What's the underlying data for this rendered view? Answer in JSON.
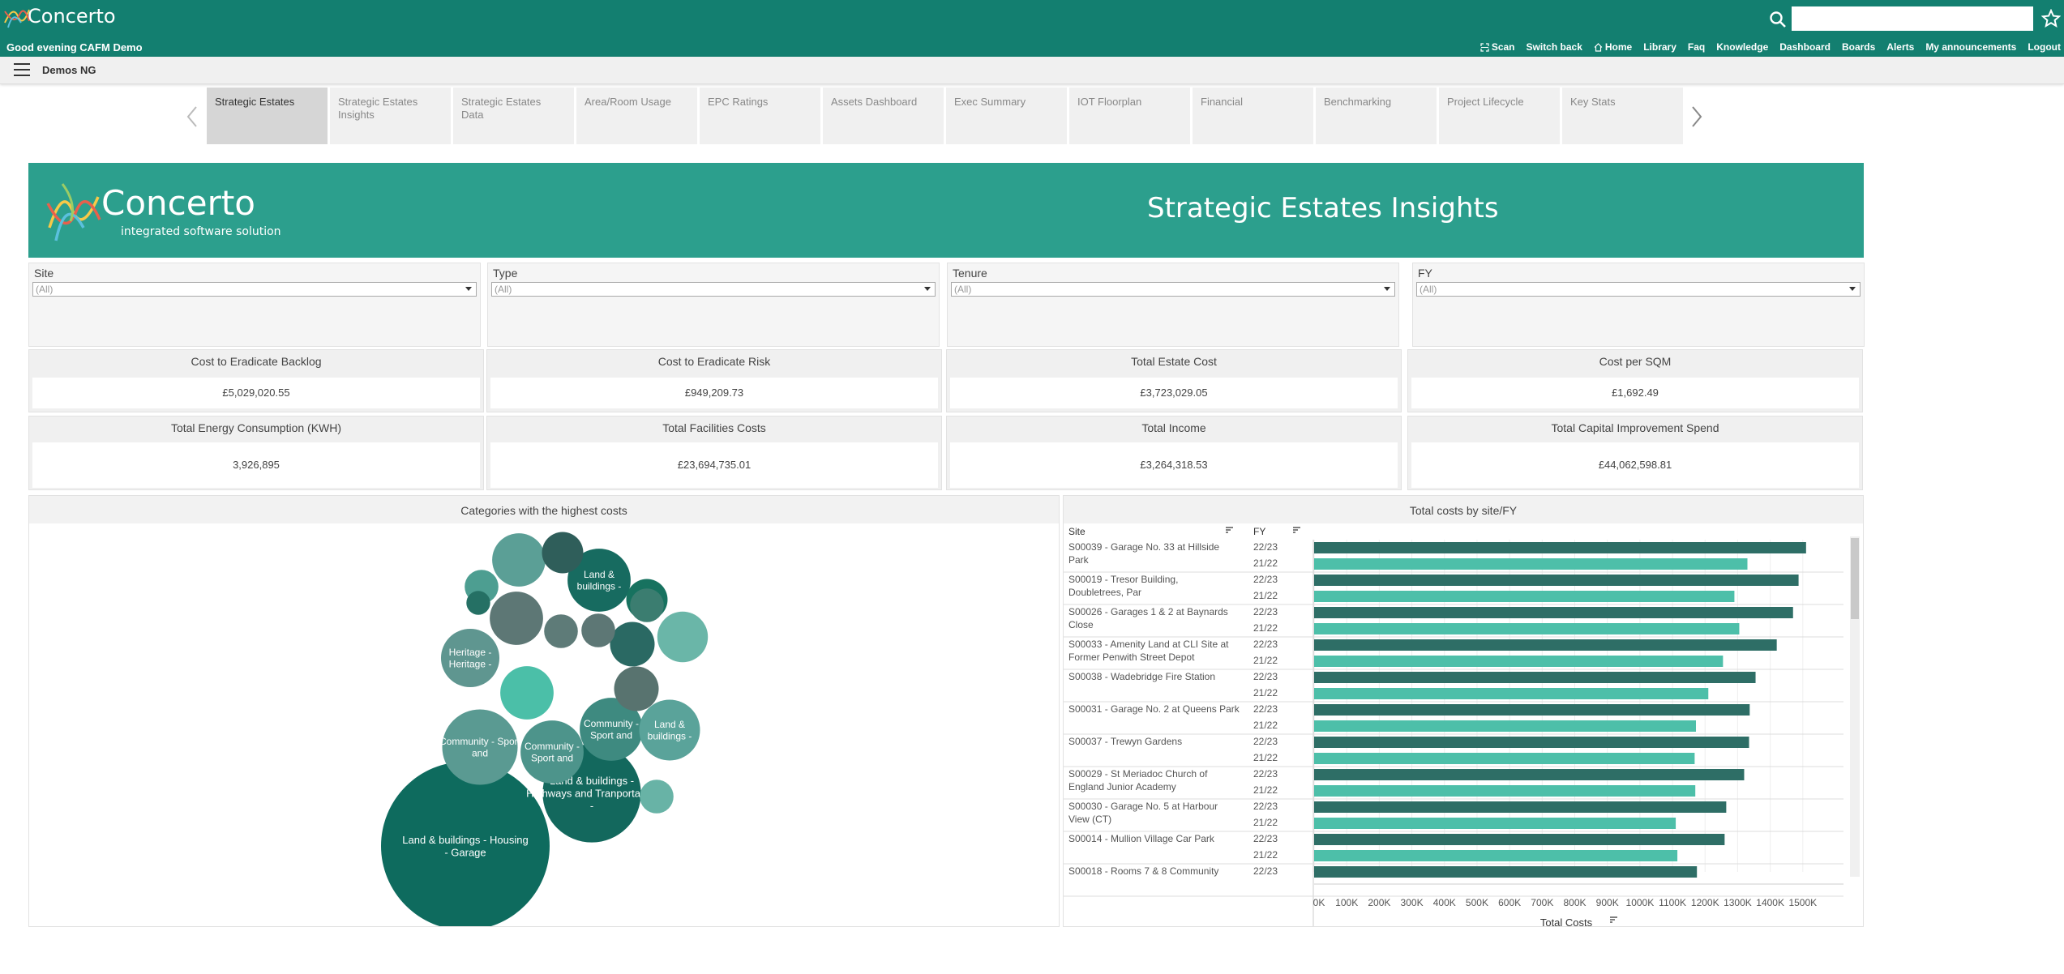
{
  "app": {
    "logo_text": "Concerto",
    "greeting": "Good evening CAFM Demo"
  },
  "topnav": [
    "Scan",
    "Switch back",
    "Home",
    "Library",
    "Faq",
    "Knowledge",
    "Dashboard",
    "Boards",
    "Alerts",
    "My announcements",
    "Logout"
  ],
  "search": {
    "value": ""
  },
  "breadcrumb": "Demos NG",
  "tabs": [
    "Strategic Estates",
    "Strategic Estates Insights",
    "Strategic Estates Data",
    "Area/Room Usage",
    "EPC Ratings",
    "Assets Dashboard",
    "Exec Summary",
    "IOT Floorplan",
    "Financial",
    "Benchmarking",
    "Project Lifecycle",
    "Key Stats"
  ],
  "active_tab": "Strategic Estates",
  "banner": {
    "logo_text": "Concerto",
    "logo_tagline": "integrated software solutions",
    "title": "Strategic Estates Insights",
    "color": "#2c9f8d"
  },
  "filters": [
    {
      "label": "Site",
      "value": "(All)"
    },
    {
      "label": "Type",
      "value": "(All)"
    },
    {
      "label": "Tenure",
      "value": "(All)"
    },
    {
      "label": "FY",
      "value": "(All)"
    }
  ],
  "kpis": [
    {
      "title": "Cost to Eradicate Backlog",
      "value": "£5,029,020.55"
    },
    {
      "title": "Cost to Eradicate Risk",
      "value": "£949,209.73"
    },
    {
      "title": "Total Estate Cost",
      "value": "£3,723,029.05"
    },
    {
      "title": "Cost per SQM",
      "value": "£1,692.49"
    },
    {
      "title": "Total Energy Consumption (KWH)",
      "value": "3,926,895"
    },
    {
      "title": "Total Facilities Costs",
      "value": "£23,694,735.01"
    },
    {
      "title": "Total Income",
      "value": "£3,264,318.53"
    },
    {
      "title": "Total Capital Improvement Spend",
      "value": "£44,062,598.81"
    }
  ],
  "colors": {
    "header": "#137f70",
    "bar_2223": "#2e6e66",
    "bar_2122": "#4dbfa9"
  },
  "chart_data": [
    {
      "type": "bubble",
      "title": "Categories with the highest costs",
      "bubbles": [
        {
          "label": "Land & buildings - Housing - Garage",
          "size": 100,
          "color": "#0e6b5e"
        },
        {
          "label": "Land & buildings - Highways and Tranportation -",
          "size": 34,
          "color": "#13685d"
        },
        {
          "label": "Community - Sport and",
          "size": 20,
          "color": "#5a9a92"
        },
        {
          "label": "Community - Sport and",
          "size": 14,
          "color": "#4d948b"
        },
        {
          "label": "Community - Sport and",
          "size": 14,
          "color": "#3e8a80"
        },
        {
          "label": "Land & buildings -",
          "size": 13,
          "color": "#5aa39a"
        },
        {
          "label": "Heritage - Heritage -",
          "size": 12,
          "color": "#5f9690"
        },
        {
          "label": "Land & buildings -",
          "size": 14,
          "color": "#176b60"
        },
        {
          "label": "",
          "size": 10,
          "color": "#4bbfa8"
        },
        {
          "label": "",
          "size": 10,
          "color": "#5b9f96"
        },
        {
          "label": "",
          "size": 10,
          "color": "#5d7775"
        },
        {
          "label": "",
          "size": 9,
          "color": "#6ab6a8"
        },
        {
          "label": "",
          "size": 7,
          "color": "#2a6963"
        },
        {
          "label": "",
          "size": 7,
          "color": "#58736f"
        },
        {
          "label": "",
          "size": 6,
          "color": "#2f5e5a"
        },
        {
          "label": "",
          "size": 6,
          "color": "#17725f"
        },
        {
          "label": "",
          "size": 4,
          "color": "#4d9e91"
        },
        {
          "label": "",
          "size": 4,
          "color": "#5e7b78"
        },
        {
          "label": "",
          "size": 4,
          "color": "#5d7775"
        },
        {
          "label": "",
          "size": 4,
          "color": "#3b7d70"
        },
        {
          "label": "",
          "size": 4,
          "color": "#68b3a6"
        },
        {
          "label": "",
          "size": 2,
          "color": "#257064"
        }
      ]
    },
    {
      "type": "bar",
      "orientation": "horizontal",
      "title": "Total costs by site/FY",
      "xlabel": "Total Costs",
      "col_headers": [
        "Site",
        "FY"
      ],
      "xlim": [
        0,
        1600000
      ],
      "ticks": [
        "0K",
        "100K",
        "200K",
        "300K",
        "400K",
        "500K",
        "600K",
        "700K",
        "800K",
        "900K",
        "1000K",
        "1100K",
        "1200K",
        "1300K",
        "1400K",
        "1500K"
      ],
      "sites": [
        {
          "name": "S00039 - Garage No. 33 at Hillside Park",
          "bars": [
            {
              "fy": "22/23",
              "value": 1510000
            },
            {
              "fy": "21/22",
              "value": 1330000
            }
          ]
        },
        {
          "name": "S00019 - Tresor Building, Doubletrees, Par",
          "bars": [
            {
              "fy": "22/23",
              "value": 1487000
            },
            {
              "fy": "21/22",
              "value": 1290000
            }
          ]
        },
        {
          "name": "S00026 - Garages 1 & 2 at Baynards Close",
          "bars": [
            {
              "fy": "22/23",
              "value": 1470000
            },
            {
              "fy": "21/22",
              "value": 1305000
            }
          ]
        },
        {
          "name": "S00033 - Amenity Land at CLI Site at Former Penwith Street Depot",
          "bars": [
            {
              "fy": "22/23",
              "value": 1420000
            },
            {
              "fy": "21/22",
              "value": 1255000
            }
          ]
        },
        {
          "name": "S00038 - Wadebridge Fire Station",
          "bars": [
            {
              "fy": "22/23",
              "value": 1355000
            },
            {
              "fy": "21/22",
              "value": 1210000
            }
          ]
        },
        {
          "name": "S00031 - Garage No. 2 at Queens Park",
          "bars": [
            {
              "fy": "22/23",
              "value": 1337000
            },
            {
              "fy": "21/22",
              "value": 1172000
            }
          ]
        },
        {
          "name": "S00037 - Trewyn Gardens",
          "bars": [
            {
              "fy": "22/23",
              "value": 1335000
            },
            {
              "fy": "21/22",
              "value": 1168000
            }
          ]
        },
        {
          "name": "S00029 - St Meriadoc Church of England Junior Academy",
          "bars": [
            {
              "fy": "22/23",
              "value": 1320000
            },
            {
              "fy": "21/22",
              "value": 1170000
            }
          ]
        },
        {
          "name": "S00030 - Garage No. 5 at Harbour View (CT)",
          "bars": [
            {
              "fy": "22/23",
              "value": 1265000
            },
            {
              "fy": "21/22",
              "value": 1110000
            }
          ]
        },
        {
          "name": "S00014 - Mullion Village Car Park",
          "bars": [
            {
              "fy": "22/23",
              "value": 1260000
            },
            {
              "fy": "21/22",
              "value": 1115000
            }
          ]
        },
        {
          "name": "S00018 - Rooms 7 & 8 Community",
          "bars": [
            {
              "fy": "22/23",
              "value": 1175000
            }
          ]
        }
      ]
    }
  ]
}
